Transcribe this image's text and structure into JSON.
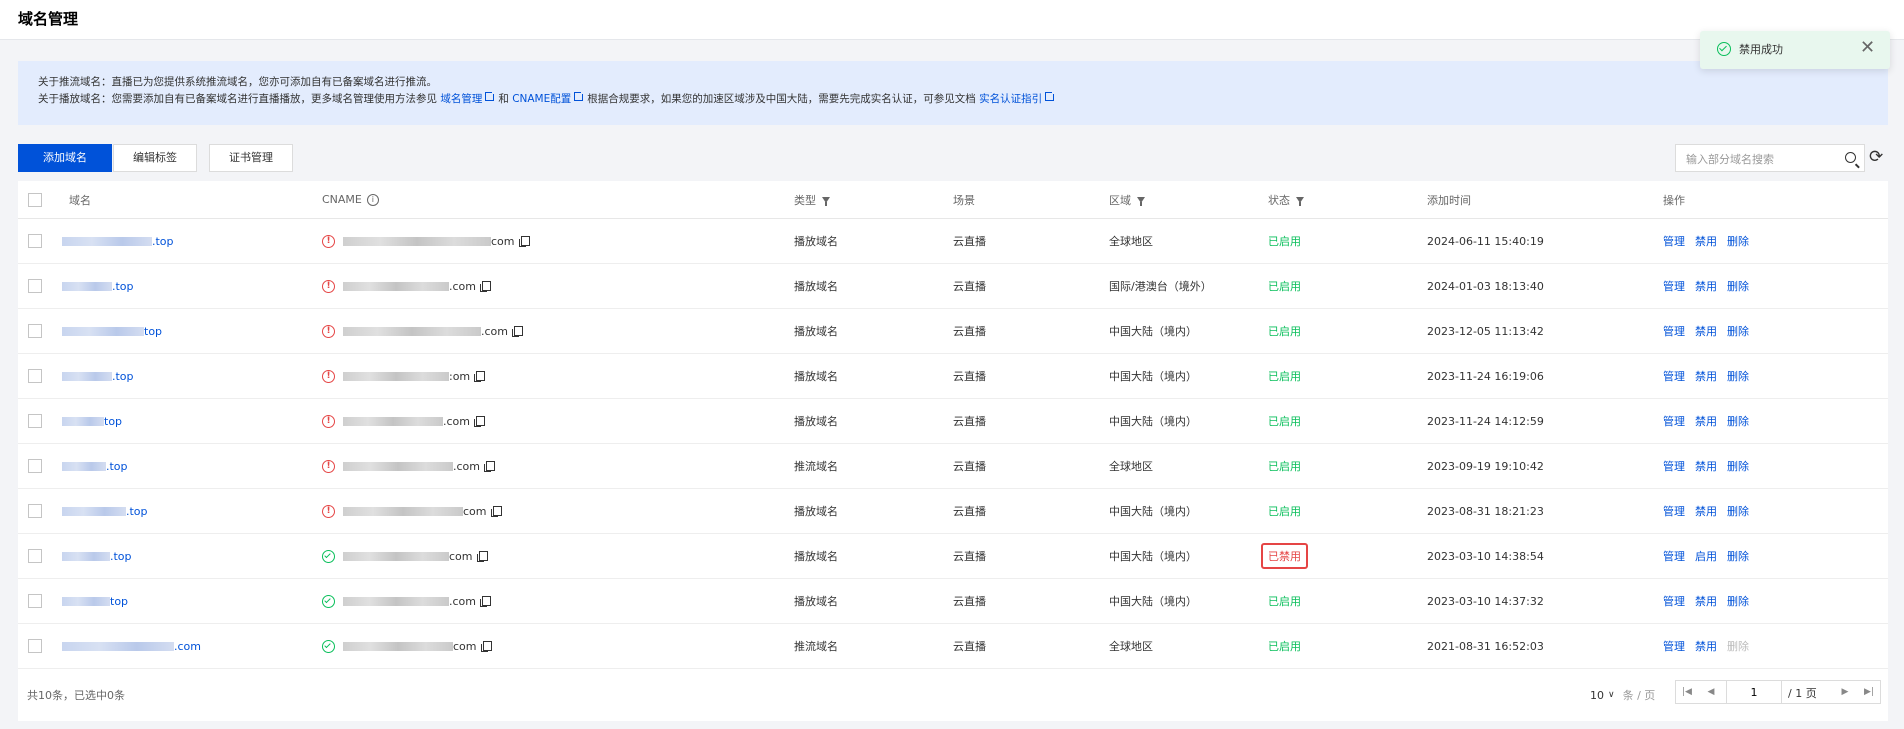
{
  "header": {
    "title": "域名管理"
  },
  "toast": {
    "message": "禁用成功",
    "close": "✕"
  },
  "notice": {
    "line1": "关于推流域名：直播已为您提供系统推流域名，您亦可添加自有已备案域名进行推流。",
    "line2_prefix": "关于播放域名：您需要添加自有已备案域名进行直播播放，更多域名管理使用方法参见",
    "link1": "域名管理",
    "and": "和",
    "link2": "CNAME配置",
    "line2_mid": "根据合规要求，如果您的加速区域涉及中国大陆，需要先完成实名认证，可参见文档",
    "link3": "实名认证指引"
  },
  "toolbar": {
    "add_label": "添加域名",
    "edit_tags_label": "编辑标签",
    "cert_label": "证书管理",
    "search_placeholder": "输入部分域名搜索"
  },
  "table": {
    "columns": {
      "domain": "域名",
      "cname": "CNAME",
      "type": "类型",
      "scene": "场景",
      "region": "区域",
      "status": "状态",
      "added": "添加时间",
      "ops": "操作"
    },
    "rows": [
      {
        "domain_suffix": ".top",
        "cname_suffix": "com",
        "cname_ok": false,
        "type": "播放域名",
        "scene": "云直播",
        "region": "全球地区",
        "status": "已启用",
        "status_ok": true,
        "added": "2024-06-11 15:40:19",
        "op1": "管理",
        "op2": "禁用",
        "op3": "删除"
      },
      {
        "domain_suffix": ".top",
        "cname_suffix": ".com",
        "cname_ok": false,
        "type": "播放域名",
        "scene": "云直播",
        "region": "国际/港澳台（境外）",
        "status": "已启用",
        "status_ok": true,
        "added": "2024-01-03 18:13:40",
        "op1": "管理",
        "op2": "禁用",
        "op3": "删除"
      },
      {
        "domain_suffix": "top",
        "cname_suffix": ".com",
        "cname_ok": false,
        "type": "播放域名",
        "scene": "云直播",
        "region": "中国大陆（境内）",
        "status": "已启用",
        "status_ok": true,
        "added": "2023-12-05 11:13:42",
        "op1": "管理",
        "op2": "禁用",
        "op3": "删除"
      },
      {
        "domain_suffix": ".top",
        "cname_suffix": ":om",
        "cname_ok": false,
        "type": "播放域名",
        "scene": "云直播",
        "region": "中国大陆（境内）",
        "status": "已启用",
        "status_ok": true,
        "added": "2023-11-24 16:19:06",
        "op1": "管理",
        "op2": "禁用",
        "op3": "删除"
      },
      {
        "domain_suffix": "top",
        "cname_suffix": ".com",
        "cname_ok": false,
        "type": "播放域名",
        "scene": "云直播",
        "region": "中国大陆（境内）",
        "status": "已启用",
        "status_ok": true,
        "added": "2023-11-24 14:12:59",
        "op1": "管理",
        "op2": "禁用",
        "op3": "删除"
      },
      {
        "domain_suffix": ".top",
        "cname_suffix": ".com",
        "cname_ok": false,
        "type": "推流域名",
        "scene": "云直播",
        "region": "全球地区",
        "status": "已启用",
        "status_ok": true,
        "added": "2023-09-19 19:10:42",
        "op1": "管理",
        "op2": "禁用",
        "op3": "删除"
      },
      {
        "domain_suffix": ".top",
        "cname_suffix": "com",
        "cname_ok": false,
        "type": "播放域名",
        "scene": "云直播",
        "region": "中国大陆（境内）",
        "status": "已启用",
        "status_ok": true,
        "added": "2023-08-31 18:21:23",
        "op1": "管理",
        "op2": "禁用",
        "op3": "删除"
      },
      {
        "domain_suffix": ".top",
        "cname_suffix": "com",
        "cname_ok": true,
        "type": "播放域名",
        "scene": "云直播",
        "region": "中国大陆（境内）",
        "status": "已禁用",
        "status_ok": false,
        "added": "2023-03-10 14:38:54",
        "op1": "管理",
        "op2": "启用",
        "op3": "删除"
      },
      {
        "domain_suffix": "top",
        "cname_suffix": ".com",
        "cname_ok": true,
        "type": "播放域名",
        "scene": "云直播",
        "region": "中国大陆（境内）",
        "status": "已启用",
        "status_ok": true,
        "added": "2023-03-10 14:37:32",
        "op1": "管理",
        "op2": "禁用",
        "op3": "删除"
      },
      {
        "domain_suffix": ".com",
        "cname_suffix": "com",
        "cname_ok": true,
        "type": "推流域名",
        "scene": "云直播",
        "region": "全球地区",
        "status": "已启用",
        "status_ok": true,
        "added": "2021-08-31 16:52:03",
        "op1": "管理",
        "op2": "禁用",
        "op3": "删除"
      }
    ]
  },
  "footer": {
    "summary": "共10条，已选中0条",
    "page_size": "10",
    "per_page": "条 / 页",
    "page_value": "1",
    "total_pages": "/ 1 页"
  },
  "colors": {
    "primary": "#0052d9",
    "success": "#0abf5b",
    "danger": "#e54545"
  }
}
